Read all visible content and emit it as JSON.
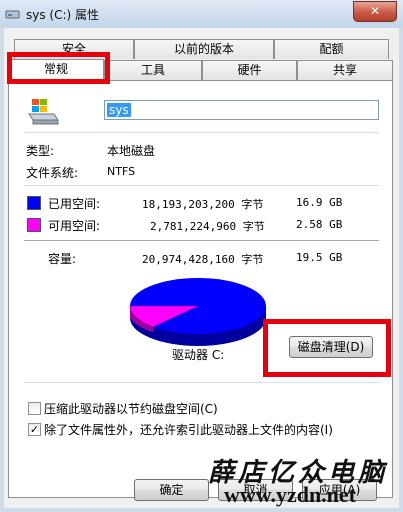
{
  "window": {
    "title": "sys (C:) 属性",
    "close_symbol": "✕"
  },
  "tabs_row1": [
    "安全",
    "以前的版本",
    "配额"
  ],
  "tabs_row2": [
    "常规",
    "工具",
    "硬件",
    "共享"
  ],
  "general": {
    "name_value": "sys",
    "type_label": "类型:",
    "type_value": "本地磁盘",
    "fs_label": "文件系统:",
    "fs_value": "NTFS",
    "used_label": "已用空间:",
    "used_bytes": "18,193,203,200 字节",
    "used_size": "16.9 GB",
    "free_label": "可用空间:",
    "free_bytes": "2,781,224,960 字节",
    "free_size": "2.58 GB",
    "capacity_label": "容量:",
    "capacity_bytes": "20,974,428,160 字节",
    "capacity_size": "19.5 GB",
    "drive_label": "驱动器 C:",
    "cleanup_button": "磁盘清理(D)",
    "compress_label": "压缩此驱动器以节约磁盘空间(C)",
    "index_label": "除了文件属性外，还允许索引此驱动器上文件的内容(I)",
    "index_checked": "✓"
  },
  "footer": {
    "ok": "确定",
    "cancel": "取消",
    "apply": "应用(A)"
  },
  "colors": {
    "used": "#0000ff",
    "free": "#ff00ff",
    "highlight": "#e8000b"
  },
  "icons": [
    "windows-drive-icon",
    "close-icon",
    "checkbox-checked-icon"
  ],
  "watermark": {
    "line1": "薛店亿众电脑",
    "line2": "www.yzdn.net"
  }
}
